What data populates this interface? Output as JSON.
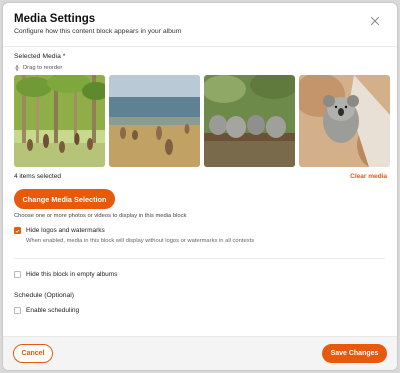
{
  "dialog": {
    "title": "Media Settings",
    "subtitle": "Configure how this content block appears in your album",
    "close_icon": "close-icon"
  },
  "media": {
    "label": "Selected Media *",
    "drag_hint": "Drag to reorder",
    "items": [
      {
        "alt": "Kangaroos among trees"
      },
      {
        "alt": "Kangaroos on the beach"
      },
      {
        "alt": "Koalas resting on a branch"
      },
      {
        "alt": "Koala in a tree"
      }
    ],
    "count_text": "4 items selected",
    "clear_label": "Clear media",
    "change_button": "Change Media Selection",
    "change_description": "Choose one or more photos or videos to display in this media block"
  },
  "options": {
    "hide_logos_label": "Hide logos and watermarks",
    "hide_logos_checked": true,
    "hide_logos_help": "When enabled, media in this block will display without logos or watermarks in all contexts",
    "hide_empty_label": "Hide this block in empty albums",
    "hide_empty_checked": false
  },
  "schedule": {
    "label": "Schedule (Optional)",
    "enable_label": "Enable scheduling",
    "enable_checked": false
  },
  "footer": {
    "cancel_label": "Cancel",
    "save_label": "Save Changes"
  },
  "colors": {
    "accent": "#e8590c",
    "clear_link": "#e4570f"
  }
}
